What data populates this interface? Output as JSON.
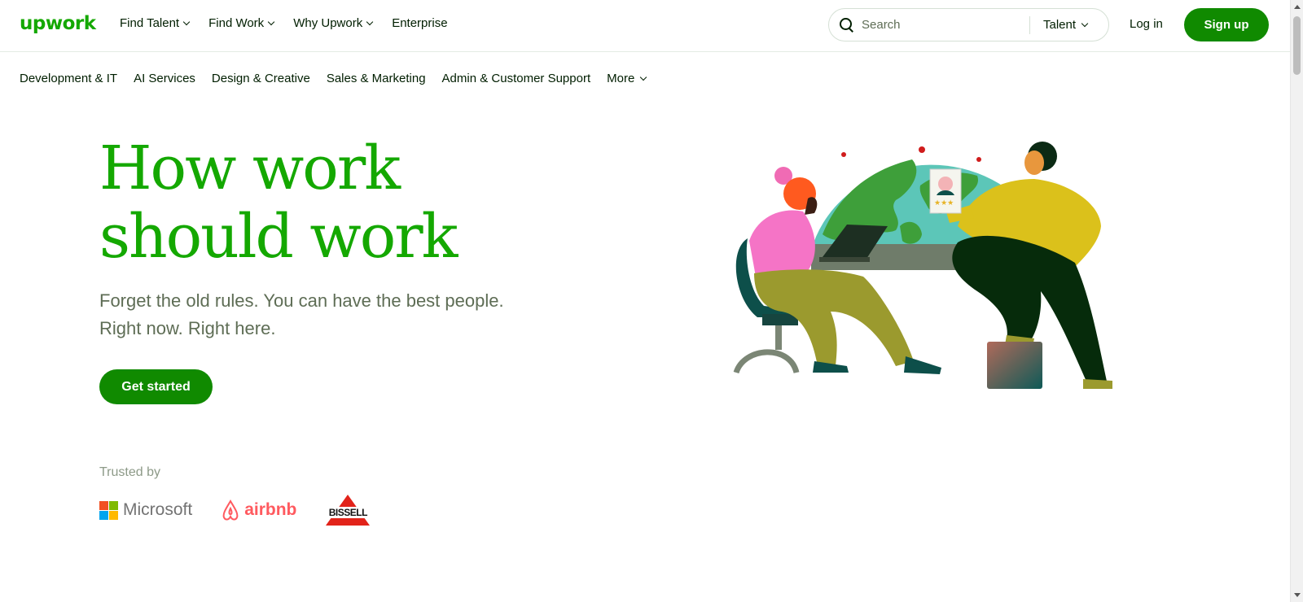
{
  "header": {
    "logo": "upwork",
    "nav": [
      {
        "label": "Find Talent",
        "dropdown": true
      },
      {
        "label": "Find Work",
        "dropdown": true
      },
      {
        "label": "Why Upwork",
        "dropdown": true
      },
      {
        "label": "Enterprise",
        "dropdown": false
      }
    ],
    "search": {
      "placeholder": "Search",
      "scope": "Talent"
    },
    "login": "Log in",
    "signup": "Sign up"
  },
  "categories": [
    "Development & IT",
    "AI Services",
    "Design & Creative",
    "Sales & Marketing",
    "Admin & Customer Support",
    "More"
  ],
  "hero": {
    "title_line1": "How work",
    "title_line2": "should work",
    "subtitle_line1": "Forget the old rules. You can have the best people.",
    "subtitle_line2": "Right now. Right here.",
    "cta": "Get started"
  },
  "trusted": {
    "label": "Trusted by",
    "logos": [
      "Microsoft",
      "airbnb",
      "BISSELL"
    ]
  },
  "colors": {
    "brand_green": "#14a800",
    "button_green": "#108a00",
    "text_dark": "#001e00",
    "text_muted": "#5e6d55"
  }
}
